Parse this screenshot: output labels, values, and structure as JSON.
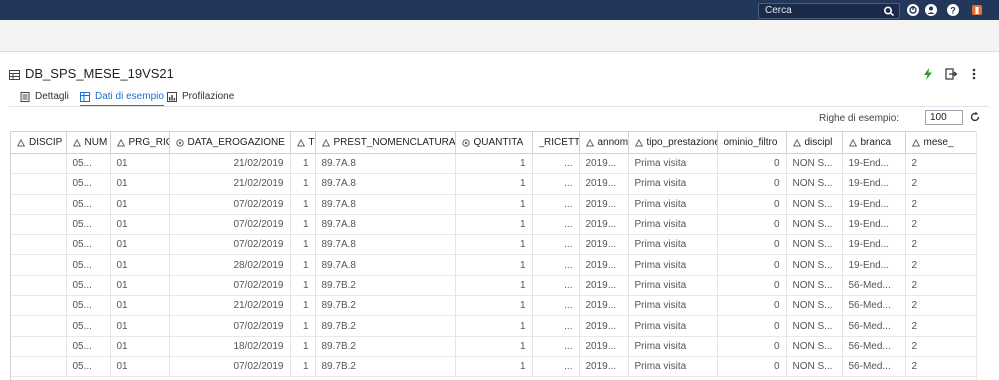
{
  "header": {
    "search_label": "Cerca"
  },
  "dataset": {
    "title": "DB_SPS_MESE_19VS21",
    "tabs": [
      {
        "label": "Dettagli"
      },
      {
        "label": "Dati di esempio"
      },
      {
        "label": "Profilazione"
      }
    ],
    "sample_rows_label": "Righe di esempio:",
    "sample_rows_value": "100"
  },
  "colors": {
    "topbar": "#23375a",
    "accent": "#1b6fd6",
    "lightning": "#2e9d2e"
  },
  "table": {
    "columns": [
      {
        "name": "DISCIP",
        "icon": "text-type-icon"
      },
      {
        "name": "NUM",
        "icon": "text-type-icon"
      },
      {
        "name": "PRG_RIGA",
        "icon": "text-type-icon"
      },
      {
        "name": "DATA_EROGAZIONE",
        "icon": "date-type-icon"
      },
      {
        "name": "TI",
        "icon": "text-type-icon"
      },
      {
        "name": "PREST_NOMENCLATURA",
        "icon": "text-type-icon"
      },
      {
        "name": "QUANTITA",
        "icon": "numeric-type-icon"
      },
      {
        "name": "_RICETTA",
        "icon": ""
      },
      {
        "name": "annom",
        "icon": "text-type-icon"
      },
      {
        "name": "tipo_prestazione",
        "icon": "text-type-icon"
      },
      {
        "name": "ominio_filtro",
        "icon": ""
      },
      {
        "name": "discipl",
        "icon": "text-type-icon"
      },
      {
        "name": "branca",
        "icon": "text-type-icon"
      },
      {
        "name": "mese_",
        "icon": "text-type-icon"
      }
    ],
    "rows": [
      [
        "",
        "05...",
        "01",
        "21/02/2019",
        "1",
        "89.7A.8",
        "1",
        "...",
        "2019...",
        "Prima visita",
        "0",
        "NON S...",
        "19-End...",
        "2"
      ],
      [
        "",
        "05...",
        "01",
        "21/02/2019",
        "1",
        "89.7A.8",
        "1",
        "...",
        "2019...",
        "Prima visita",
        "0",
        "NON S...",
        "19-End...",
        "2"
      ],
      [
        "",
        "05...",
        "01",
        "07/02/2019",
        "1",
        "89.7A.8",
        "1",
        "...",
        "2019...",
        "Prima visita",
        "0",
        "NON S...",
        "19-End...",
        "2"
      ],
      [
        "",
        "05...",
        "01",
        "07/02/2019",
        "1",
        "89.7A.8",
        "1",
        "...",
        "2019...",
        "Prima visita",
        "0",
        "NON S...",
        "19-End...",
        "2"
      ],
      [
        "",
        "05...",
        "01",
        "07/02/2019",
        "1",
        "89.7A.8",
        "1",
        "...",
        "2019...",
        "Prima visita",
        "0",
        "NON S...",
        "19-End...",
        "2"
      ],
      [
        "",
        "05...",
        "01",
        "28/02/2019",
        "1",
        "89.7A.8",
        "1",
        "...",
        "2019...",
        "Prima visita",
        "0",
        "NON S...",
        "19-End...",
        "2"
      ],
      [
        "",
        "05...",
        "01",
        "07/02/2019",
        "1",
        "89.7B.2",
        "1",
        "...",
        "2019...",
        "Prima visita",
        "0",
        "NON S...",
        "56-Med...",
        "2"
      ],
      [
        "",
        "05...",
        "01",
        "21/02/2019",
        "1",
        "89.7B.2",
        "1",
        "...",
        "2019...",
        "Prima visita",
        "0",
        "NON S...",
        "56-Med...",
        "2"
      ],
      [
        "",
        "05...",
        "01",
        "07/02/2019",
        "1",
        "89.7B.2",
        "1",
        "...",
        "2019...",
        "Prima visita",
        "0",
        "NON S...",
        "56-Med...",
        "2"
      ],
      [
        "",
        "05...",
        "01",
        "18/02/2019",
        "1",
        "89.7B.2",
        "1",
        "...",
        "2019...",
        "Prima visita",
        "0",
        "NON S...",
        "56-Med...",
        "2"
      ],
      [
        "",
        "05...",
        "01",
        "07/02/2019",
        "1",
        "89.7B.2",
        "1",
        "...",
        "2019...",
        "Prima visita",
        "0",
        "NON S...",
        "56-Med...",
        "2"
      ]
    ]
  }
}
